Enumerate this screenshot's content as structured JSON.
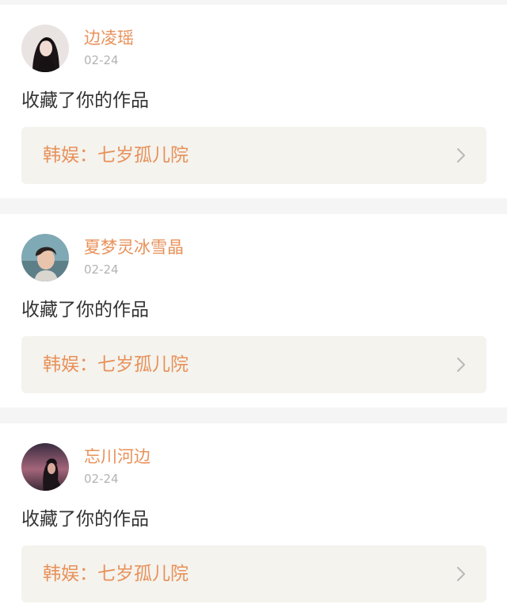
{
  "notifications": [
    {
      "user": "边凌瑶",
      "date": "02-24",
      "action": "收藏了你的作品",
      "work_title": "韩娱：七岁孤儿院",
      "avatar_icon": "user-avatar-icon"
    },
    {
      "user": "夏梦灵冰雪晶",
      "date": "02-24",
      "action": "收藏了你的作品",
      "work_title": "韩娱：七岁孤儿院",
      "avatar_icon": "user-avatar-icon"
    },
    {
      "user": "忘川河边",
      "date": "02-24",
      "action": "收藏了你的作品",
      "work_title": "韩娱：七岁孤儿院",
      "avatar_icon": "user-avatar-icon"
    }
  ],
  "colors": {
    "accent": "#e8915a",
    "date": "#b3b3b3",
    "text": "#333333",
    "work_bg": "#f4f3ee",
    "separator": "#f5f5f5"
  }
}
